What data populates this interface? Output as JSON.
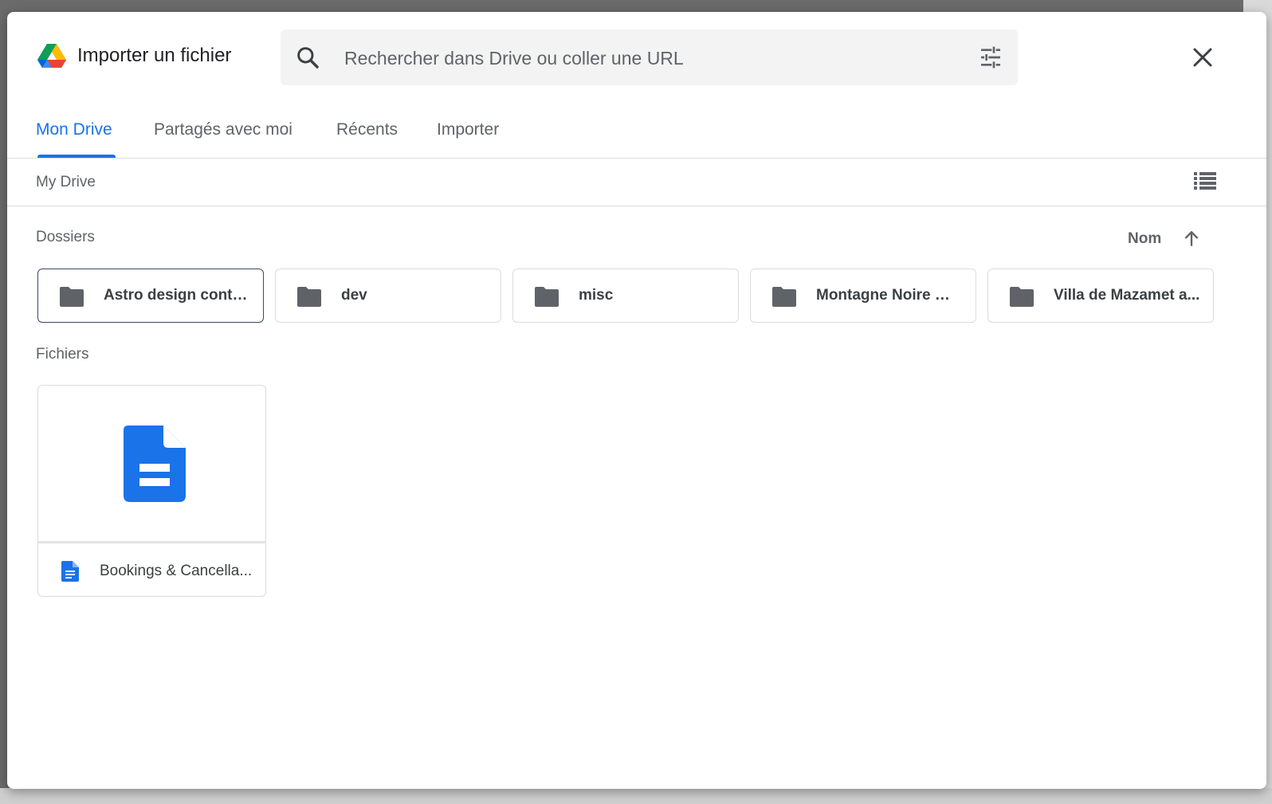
{
  "dialog": {
    "title": "Importer un fichier",
    "logo_icon": "google-drive-logo",
    "close_icon": "close-icon"
  },
  "search": {
    "placeholder": "Rechercher dans Drive ou coller une URL",
    "value": "",
    "search_icon": "search-icon",
    "filter_icon": "tune-icon"
  },
  "tabs": [
    {
      "label": "Mon Drive",
      "active": true
    },
    {
      "label": "Partagés avec moi",
      "active": false
    },
    {
      "label": "Récents",
      "active": false
    },
    {
      "label": "Importer",
      "active": false
    }
  ],
  "breadcrumb": "My Drive",
  "view_toggle_icon": "list-view-icon",
  "folders_section": {
    "label": "Dossiers",
    "sort_label": "Nom",
    "sort_icon": "arrow-up-icon",
    "items": [
      {
        "name": "Astro design conte...",
        "selected": true
      },
      {
        "name": "dev",
        "selected": false
      },
      {
        "name": "misc",
        "selected": false
      },
      {
        "name": "Montagne Noire We...",
        "selected": false
      },
      {
        "name": "Villa de Mazamet a...",
        "selected": false
      }
    ]
  },
  "files_section": {
    "label": "Fichiers",
    "items": [
      {
        "name": "Bookings & Cancella...",
        "type_icon": "google-docs-icon"
      }
    ]
  },
  "colors": {
    "accent": "#1a73e8",
    "doc_blue": "#1a73e8",
    "folder_gray": "#5f6368",
    "overlay": "#6b6b6b"
  }
}
